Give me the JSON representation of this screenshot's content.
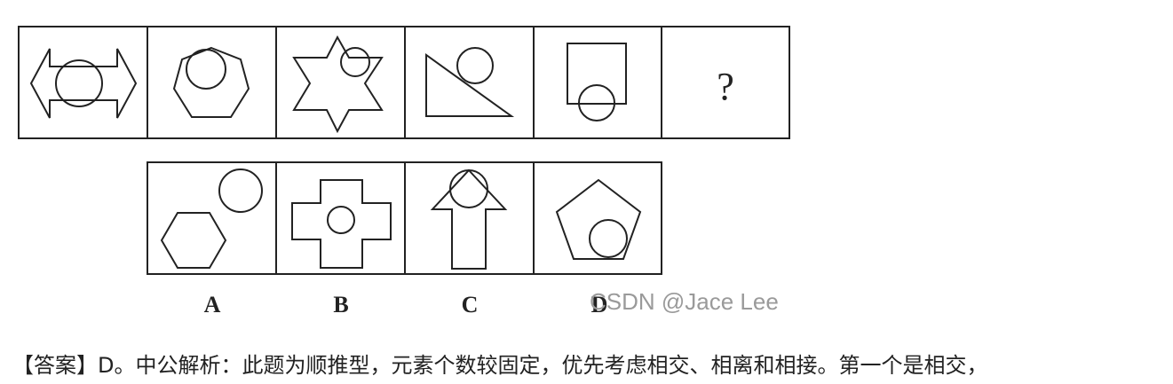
{
  "question": {
    "sequence_cells": [
      {
        "figure": "double-arrow-with-circle"
      },
      {
        "figure": "heptagon-with-circle"
      },
      {
        "figure": "star-with-circle"
      },
      {
        "figure": "right-triangle-with-circle"
      },
      {
        "figure": "square-with-circle"
      },
      {
        "figure": "question-mark",
        "text": "?"
      }
    ],
    "options": [
      {
        "label": "A",
        "figure": "hexagon-and-separate-circle"
      },
      {
        "label": "B",
        "figure": "cross-with-inner-circle"
      },
      {
        "label": "C",
        "figure": "up-arrow-with-circle"
      },
      {
        "label": "D",
        "figure": "pentagon-with-circle"
      }
    ]
  },
  "watermark": "CSDN @Jace Lee",
  "answer_text": "【答案】D。中公解析：此题为顺推型，元素个数较固定，优先考虑相交、相离和相接。第一个是相交，"
}
